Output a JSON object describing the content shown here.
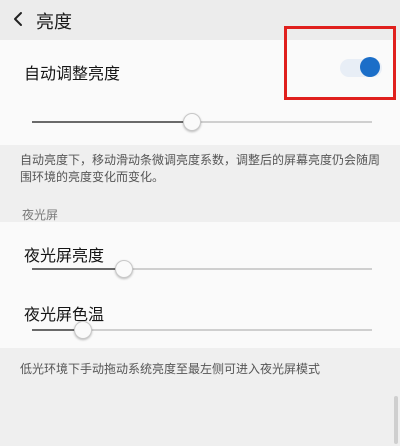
{
  "header": {
    "title": "亮度",
    "back_icon": "chevron-left-icon"
  },
  "auto_brightness": {
    "label": "自动调整亮度",
    "toggle_on": true,
    "toggle_color": "#1b6ec8",
    "slider_level": 0.47,
    "description": "自动亮度下，移动滑动条微调亮度系数，调整后的屏幕亮度仍会随周围环境的亮度变化而变化。"
  },
  "night_screen": {
    "section_title": "夜光屏",
    "brightness": {
      "label": "夜光屏亮度",
      "level": 0.27
    },
    "color_temp": {
      "label": "夜光屏色温",
      "level": 0.15
    },
    "description": "低光环境下手动拖动系统亮度至最左侧可进入夜光屏模式"
  },
  "highlight_color": "#e0201d"
}
